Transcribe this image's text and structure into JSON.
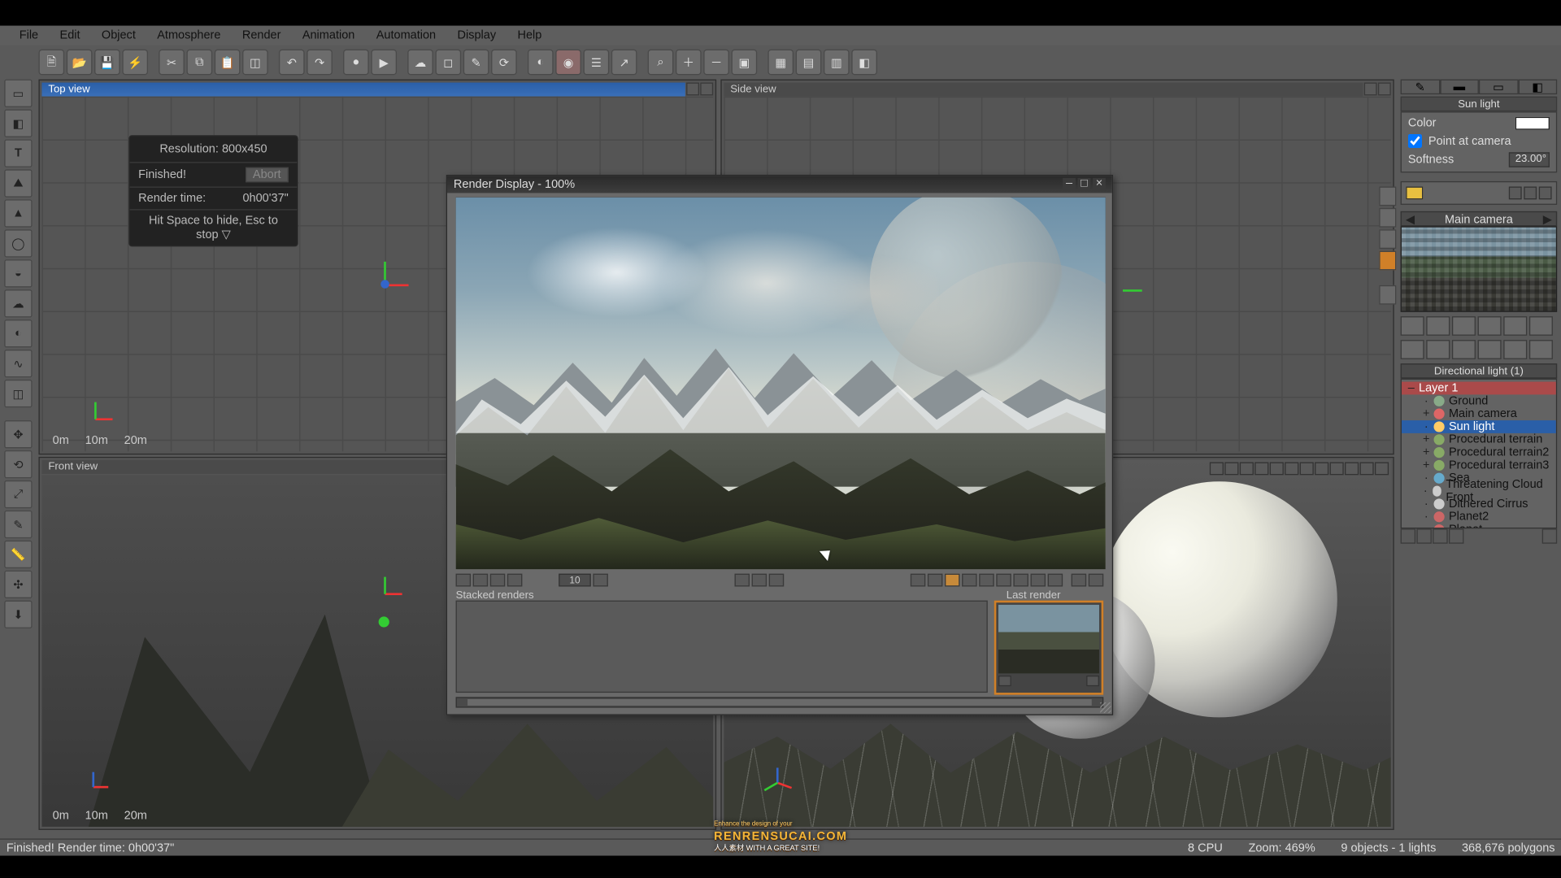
{
  "menu": [
    "File",
    "Edit",
    "Object",
    "Atmosphere",
    "Render",
    "Animation",
    "Automation",
    "Display",
    "Help"
  ],
  "viewports": {
    "top": {
      "title": "Top view",
      "scale": [
        "0m",
        "10m",
        "20m"
      ]
    },
    "side": {
      "title": "Side view"
    },
    "front": {
      "title": "Front view",
      "scale": [
        "0m",
        "10m",
        "20m"
      ]
    }
  },
  "render_status": {
    "resolution": "Resolution: 800x450",
    "finished": "Finished!",
    "abort": "Abort",
    "time_label": "Render time:",
    "time_value": "0h00'37\"",
    "hint": "Hit Space to hide, Esc to stop  ▽"
  },
  "render_window": {
    "title": "Render Display - 100%",
    "tb_num": "10",
    "stacked_label": "Stacked renders",
    "last_label": "Last render"
  },
  "right": {
    "light_title": "Sun light",
    "color_label": "Color",
    "point_label": "Point at camera",
    "soft_label": "Softness",
    "soft_value": "23.00°",
    "camera_label": "Main camera",
    "tree_title": "Directional light (1)",
    "layer": "Layer 1",
    "tree": [
      {
        "t": "Ground",
        "d": 1
      },
      {
        "t": "Main camera",
        "d": 1,
        "exp": "+",
        "ico": "#d66"
      },
      {
        "t": "Sun light",
        "d": 1,
        "sel": true,
        "ico": "#fc6"
      },
      {
        "t": "Procedural terrain",
        "d": 1,
        "exp": "+",
        "ico": "#8a6"
      },
      {
        "t": "Procedural terrain2",
        "d": 1,
        "exp": "+",
        "ico": "#8a6"
      },
      {
        "t": "Procedural terrain3",
        "d": 1,
        "exp": "+",
        "ico": "#8a6"
      },
      {
        "t": "Sea",
        "d": 1,
        "ico": "#6ac"
      },
      {
        "t": "Threatening Cloud Front",
        "d": 1,
        "ico": "#ccc"
      },
      {
        "t": "Dithered Cirrus",
        "d": 1,
        "ico": "#ccc"
      },
      {
        "t": "Planet2",
        "d": 1,
        "ico": "#c66"
      },
      {
        "t": "Planet",
        "d": 1,
        "ico": "#c66"
      }
    ]
  },
  "status": {
    "left": "Finished! Render time: 0h00'37\"",
    "cpu": "8 CPU",
    "zoom": "Zoom:  469%",
    "objs": "9 objects - 1 lights",
    "polys": "368,676 polygons"
  },
  "watermark": {
    "pre": "Enhance the design of your",
    "main": "RENRENSUCAI.COM",
    "sub": "人人素材  WITH A GREAT SITE!"
  }
}
